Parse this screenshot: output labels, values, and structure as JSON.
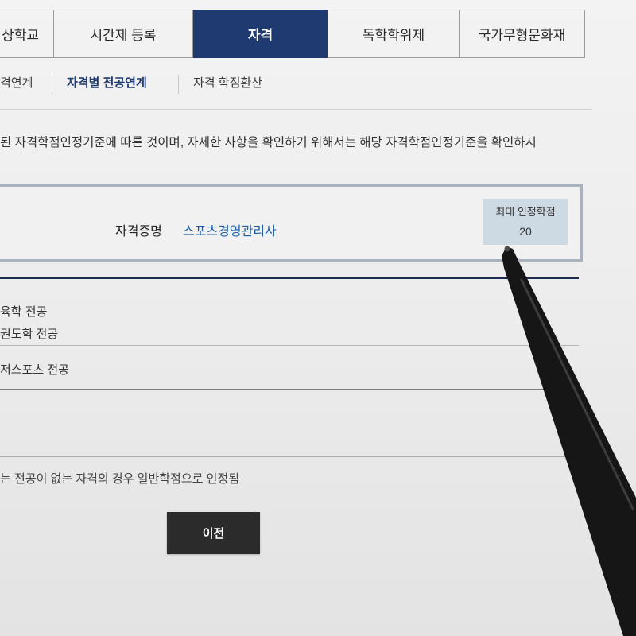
{
  "top_tabs": [
    {
      "label": "상학교",
      "active": false
    },
    {
      "label": "시간제 등록",
      "active": false
    },
    {
      "label": "자격",
      "active": true
    },
    {
      "label": "독학학위제",
      "active": false
    },
    {
      "label": "국가무형문화재",
      "active": false
    }
  ],
  "sub_tabs": [
    {
      "label": "격연계",
      "active": false
    },
    {
      "label": "자격별 전공연계",
      "active": true
    },
    {
      "label": "자격 학점환산",
      "active": false
    }
  ],
  "description": "된 자격학점인정기준에 따른 것이며, 자세한 사항을 확인하기 위해서는 해당 자격학점인정기준을 확인하시",
  "certificate": {
    "label": "자격증명",
    "name": "스포츠경영관리사",
    "max_credit_label": "최대 인정학점",
    "max_credit_value": "20"
  },
  "majors_table": {
    "rows": [
      {
        "majors": [
          "육학 전공",
          "권도학 전공"
        ]
      },
      {
        "majors": [
          "저스포츠 전공"
        ]
      },
      {
        "majors": []
      }
    ]
  },
  "note": "는 전공이 없는 자격의 경우 일반학점으로 인정됨",
  "prev_button_label": "이전",
  "colors": {
    "active_tab_bg": "#1e3a70",
    "link_blue": "#1c5ea8",
    "credit_box_bg": "#cdd9e3",
    "navy_rule": "#1c2e55",
    "button_bg": "#2b2b2b"
  }
}
